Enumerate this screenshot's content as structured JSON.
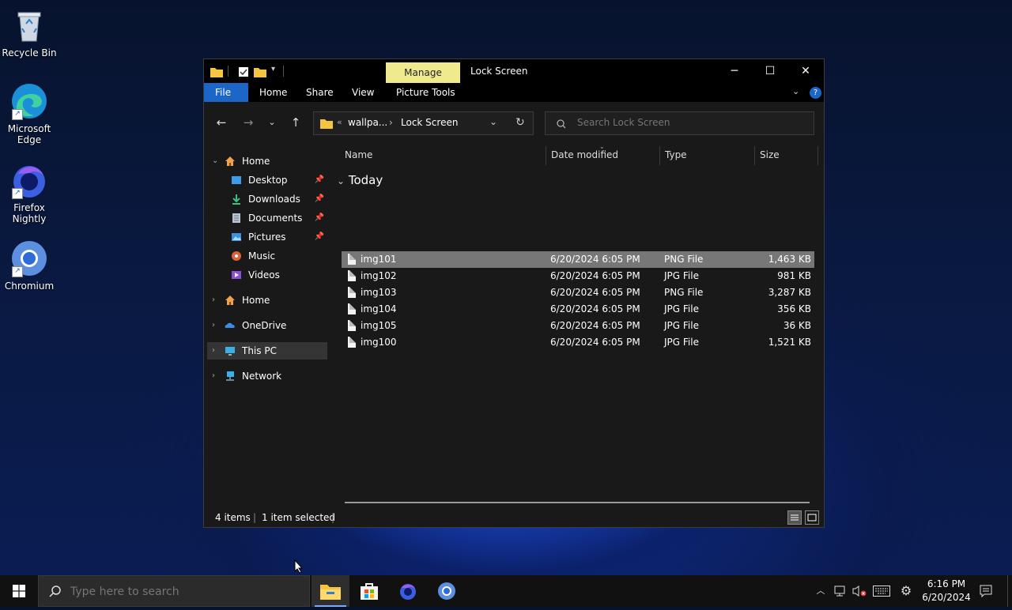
{
  "desktop": {
    "icons": [
      {
        "label": "Recycle Bin",
        "icon": "recycle-bin-icon"
      },
      {
        "label": "Microsoft Edge",
        "icon": "edge-icon"
      },
      {
        "label": "Firefox Nightly",
        "icon": "firefox-nightly-icon"
      },
      {
        "label": "Chromium",
        "icon": "chromium-icon"
      }
    ]
  },
  "window": {
    "title": "Lock Screen",
    "context_tab": "Manage",
    "ribbon_tabs": [
      "File",
      "Home",
      "Share",
      "View",
      "Picture Tools"
    ],
    "address": {
      "overflow": "«",
      "parent": "wallpa...",
      "sep": "›",
      "current": "Lock Screen"
    },
    "search_placeholder": "Search Lock Screen"
  },
  "nav_pane": {
    "items": [
      {
        "label": "Home",
        "icon": "home-icon"
      },
      {
        "label": "Desktop",
        "icon": "desktop-folder-icon"
      },
      {
        "label": "Downloads",
        "icon": "downloads-icon"
      },
      {
        "label": "Documents",
        "icon": "documents-icon"
      },
      {
        "label": "Pictures",
        "icon": "pictures-icon"
      },
      {
        "label": "Music",
        "icon": "music-icon"
      },
      {
        "label": "Videos",
        "icon": "videos-icon"
      },
      {
        "label": "Home",
        "icon": "home-icon"
      },
      {
        "label": "OneDrive",
        "icon": "onedrive-icon"
      },
      {
        "label": "This PC",
        "icon": "this-pc-icon"
      },
      {
        "label": "Network",
        "icon": "network-icon"
      }
    ]
  },
  "file_list": {
    "columns": [
      "Name",
      "Date modified",
      "Type",
      "Size"
    ],
    "group": "Today",
    "rows": [
      {
        "name": "img101",
        "date": "6/20/2024 6:05 PM",
        "type": "PNG File",
        "size": "1,463 KB"
      },
      {
        "name": "img102",
        "date": "6/20/2024 6:05 PM",
        "type": "JPG File",
        "size": "981 KB"
      },
      {
        "name": "img103",
        "date": "6/20/2024 6:05 PM",
        "type": "PNG File",
        "size": "3,287 KB"
      },
      {
        "name": "img104",
        "date": "6/20/2024 6:05 PM",
        "type": "JPG File",
        "size": "356 KB"
      },
      {
        "name": "img105",
        "date": "6/20/2024 6:05 PM",
        "type": "JPG File",
        "size": "36 KB"
      },
      {
        "name": "img100",
        "date": "6/20/2024 6:05 PM",
        "type": "JPG File",
        "size": "1,521 KB"
      }
    ],
    "selected_row": "img101"
  },
  "status": {
    "items": "4 items",
    "selected": "1 item selected"
  },
  "taskbar": {
    "search_placeholder": "Type here to search",
    "time": "6:16 PM",
    "date": "6/20/2024"
  },
  "colors": {
    "accent": "#1b66c7",
    "manage_tab": "#f0ea8e",
    "selection": "#777777"
  }
}
